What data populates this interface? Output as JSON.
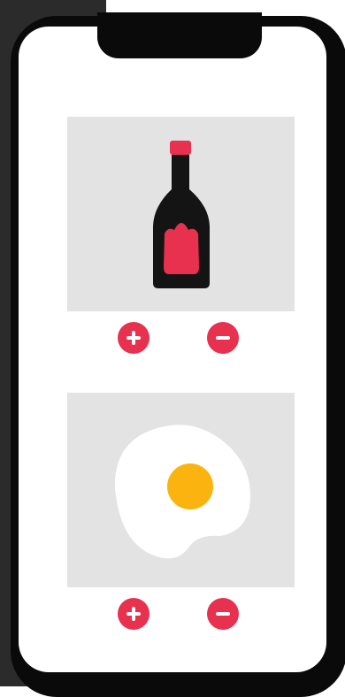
{
  "items": [
    {
      "icon": "ketchup-bottle-icon",
      "controls": [
        "plus-icon",
        "minus-icon"
      ]
    },
    {
      "icon": "fried-egg-icon",
      "controls": [
        "plus-icon",
        "minus-icon"
      ]
    }
  ],
  "colors": {
    "accent": "#e8304f",
    "card_background": "#e3e3e3",
    "bottle": "#141414",
    "yolk": "#fbb40f",
    "egg_white": "#ffffff",
    "phone_frame": "#0a0a0a"
  }
}
